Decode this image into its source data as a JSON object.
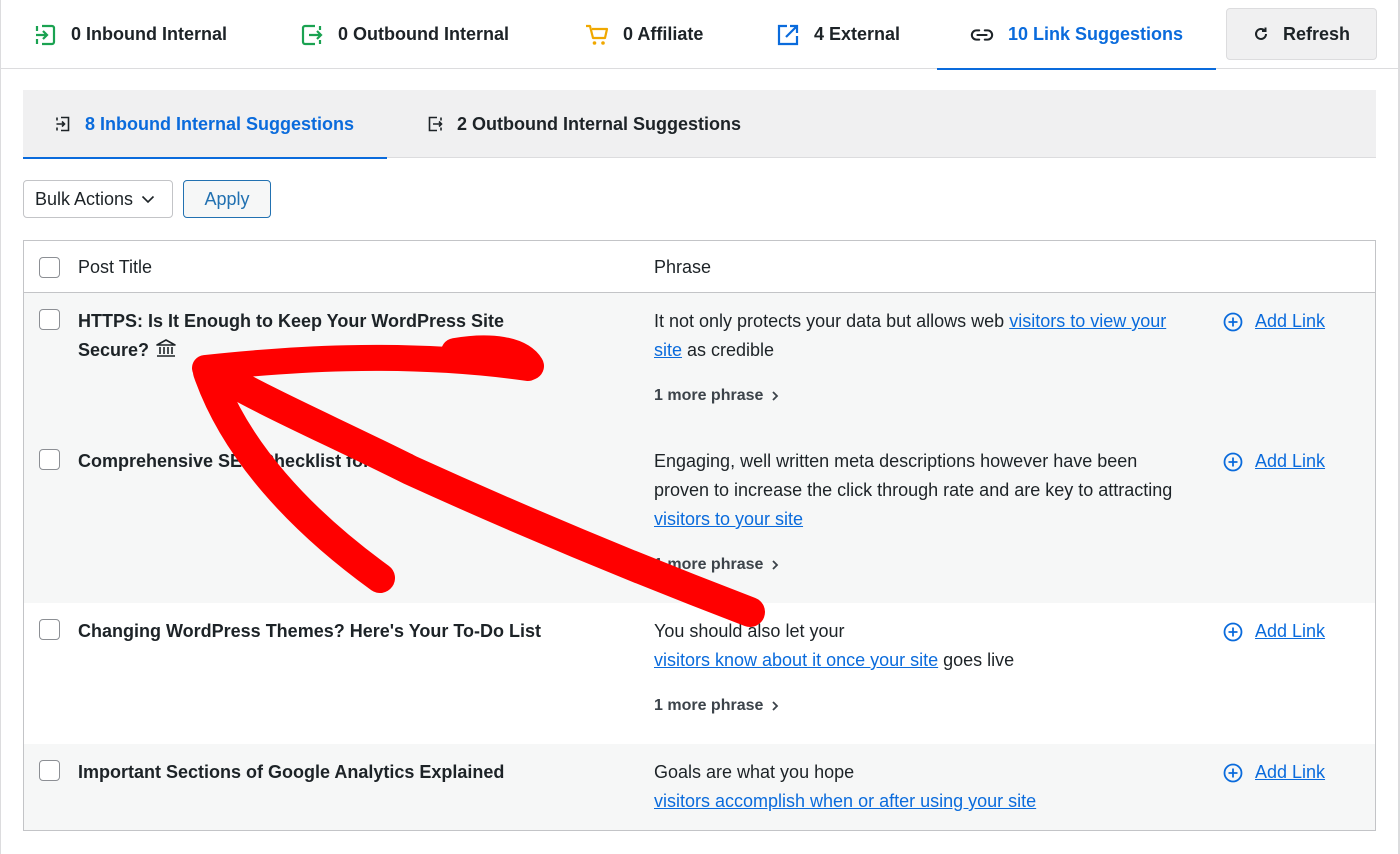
{
  "top_tabs": [
    {
      "label": "0 Inbound Internal",
      "icon": "inbound-icon",
      "color": "#1aa251"
    },
    {
      "label": "0 Outbound Internal",
      "icon": "outbound-icon",
      "color": "#1aa251"
    },
    {
      "label": "0 Affiliate",
      "icon": "cart-icon",
      "color": "#f0a800"
    },
    {
      "label": "4 External",
      "icon": "external-link-icon",
      "color": "#0a6bdc"
    },
    {
      "label": "10 Link Suggestions",
      "icon": "link-icon",
      "color": "#1d2327",
      "active": true
    }
  ],
  "refresh_label": "Refresh",
  "sub_tabs": [
    {
      "label": "8 Inbound Internal Suggestions",
      "icon": "inbound-icon",
      "active": true
    },
    {
      "label": "2 Outbound Internal Suggestions",
      "icon": "outbound-icon"
    }
  ],
  "bulk_actions": {
    "selected": "Bulk Actions",
    "apply_label": "Apply"
  },
  "table": {
    "columns": [
      "Post Title",
      "Phrase"
    ],
    "rows": [
      {
        "title": "HTTPS: Is It Enough to Keep Your WordPress Site Secure?",
        "title_icon": "pillar-icon",
        "phrase_before": "It not only protects your data but allows web ",
        "phrase_link": "visitors to view your site",
        "phrase_after": " as credible",
        "more": "1 more phrase",
        "action": "Add Link"
      },
      {
        "title": "Comprehensive SEO Checklist for 2016",
        "phrase_before": "Engaging, well written meta descriptions however have been proven to increase the click through rate and are key to attracting ",
        "phrase_link": "visitors to your site",
        "phrase_after": "",
        "more": "1 more phrase",
        "action": "Add Link"
      },
      {
        "title": "Changing WordPress Themes? Here's Your To-Do List",
        "phrase_before": "You should also let your ",
        "phrase_link": "visitors know about it once your site",
        "phrase_after": " goes live",
        "more": "1 more phrase",
        "action": "Add Link"
      },
      {
        "title": "Important Sections of Google Analytics Explained",
        "phrase_before": "Goals are what you hope ",
        "phrase_link": "visitors accomplish when or after using your site",
        "phrase_after": "",
        "action": "Add Link"
      }
    ]
  },
  "annotation": {
    "type": "red-arrow",
    "color": "#ff0000",
    "points_to": "pillar-icon"
  }
}
